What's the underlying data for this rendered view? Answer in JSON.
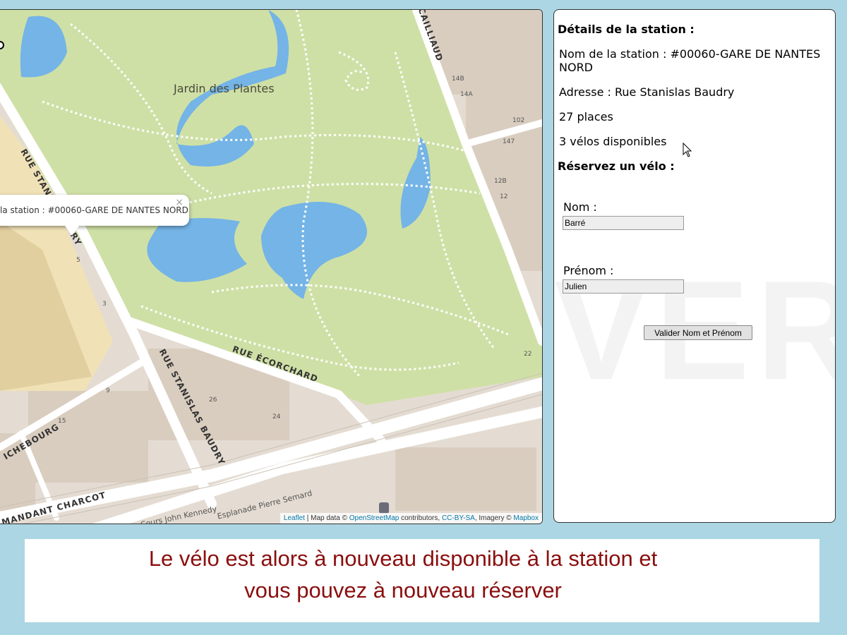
{
  "map": {
    "park_label": "Jardin des Plantes",
    "streets": {
      "stanislas_upper": "RUE STANIS",
      "stanislas_lower": "RUE STANISLAS BAUDRY",
      "ecorchard": "RUE ÉCORCHARD",
      "charcot": "MANDANT CHARCOT",
      "cailliaud": "CAILLIAUD",
      "richebourg": "ICHEBOURG",
      "kennedy": "Cours John Kennedy",
      "semard": "Esplanade Pierre Semard",
      "ry": "RY"
    },
    "house_numbers": [
      "14B",
      "14A",
      "102",
      "147",
      "12B",
      "12",
      "26",
      "24",
      "22",
      "15",
      "9",
      "3",
      "5"
    ],
    "popup": {
      "text": "la station : #00060-GARE DE NANTES NORD",
      "close": "×"
    },
    "attribution": {
      "leaflet": "Leaflet",
      "mid1": " | Map data © ",
      "osm": "OpenStreetMap",
      "mid2": " contributors, ",
      "ccbysa": "CC-BY-SA",
      "mid3": ", Imagery © ",
      "mapbox": "Mapbox"
    }
  },
  "panel": {
    "title": "Détails de la station :",
    "station_name": "Nom de la station : #00060-GARE DE NANTES NORD",
    "address": "Adresse : Rue Stanislas Baudry",
    "places": "27 places",
    "bikes": "3 vélos disponibles",
    "reserve_title": "Réservez un vélo :",
    "nom_label": "Nom :",
    "nom_value": "Barré",
    "prenom_label": "Prénom :",
    "prenom_value": "Julien",
    "validate_label": "Valider Nom et Prénom",
    "watermark": "VERSION"
  },
  "caption": {
    "line1": "Le vélo est alors à nouveau disponible à la station et",
    "line2": "vous pouvez à nouveau réserver"
  },
  "colors": {
    "background": "#acd6e3",
    "park": "#cfe0a6",
    "water": "#74b4e6",
    "caption_text": "#8b0e0e",
    "link": "#0078a8"
  }
}
